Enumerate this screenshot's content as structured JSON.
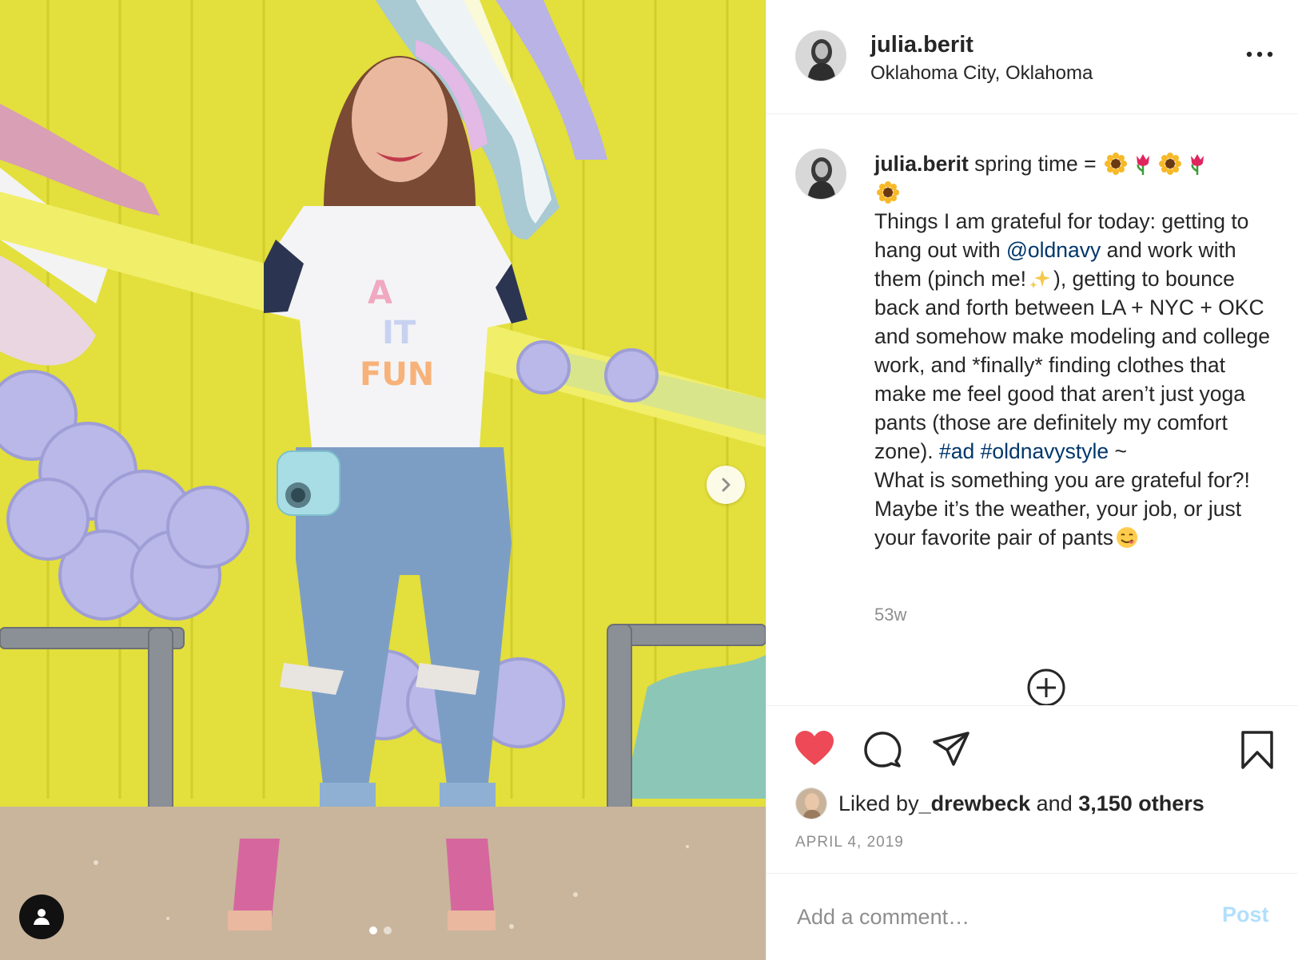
{
  "post": {
    "username": "julia.berit",
    "location": "Oklahoma City, Oklahoma",
    "more_icon": "more-horizontal-icon"
  },
  "caption": {
    "username": "julia.berit",
    "intro": " spring time = ",
    "emojis": [
      "sunflower",
      "tulip",
      "sunflower",
      "tulip",
      "sunflower"
    ],
    "para1_a": "Things I am grateful for today: getting to hang out with ",
    "mention": "@oldnavy",
    "para1_b": " and work with them (pinch me!",
    "sparkle_emoji": "sparkles",
    "para1_c": "), getting to bounce back and forth between LA + NYC + OKC and somehow make modeling and college work, and *finally* finding clothes that make me feel good that aren’t just yoga pants (those are definitely my comfort zone). ",
    "hashtag1": "#ad",
    "hashtag2": "#oldnavystyle",
    "tilde": " ~",
    "para2": "What is something you are grateful for?! Maybe it’s the weather, your job, or just your favorite pair of pants",
    "end_emoji": "yummy-face",
    "time_ago": "53w"
  },
  "actions": {
    "liked": true,
    "like_color": "#ed4956",
    "icons": [
      "heart-icon",
      "comment-icon",
      "share-icon",
      "bookmark-icon"
    ]
  },
  "likes": {
    "prefix": "Liked by ",
    "liker": "_drewbeck",
    "and": " and ",
    "others": "3,150 others"
  },
  "date": "APRIL 4, 2019",
  "comment": {
    "placeholder": "Add a comment…",
    "post_label": "Post",
    "post_color": "#b2dffc"
  },
  "carousel": {
    "slides": 2,
    "active": 1
  }
}
